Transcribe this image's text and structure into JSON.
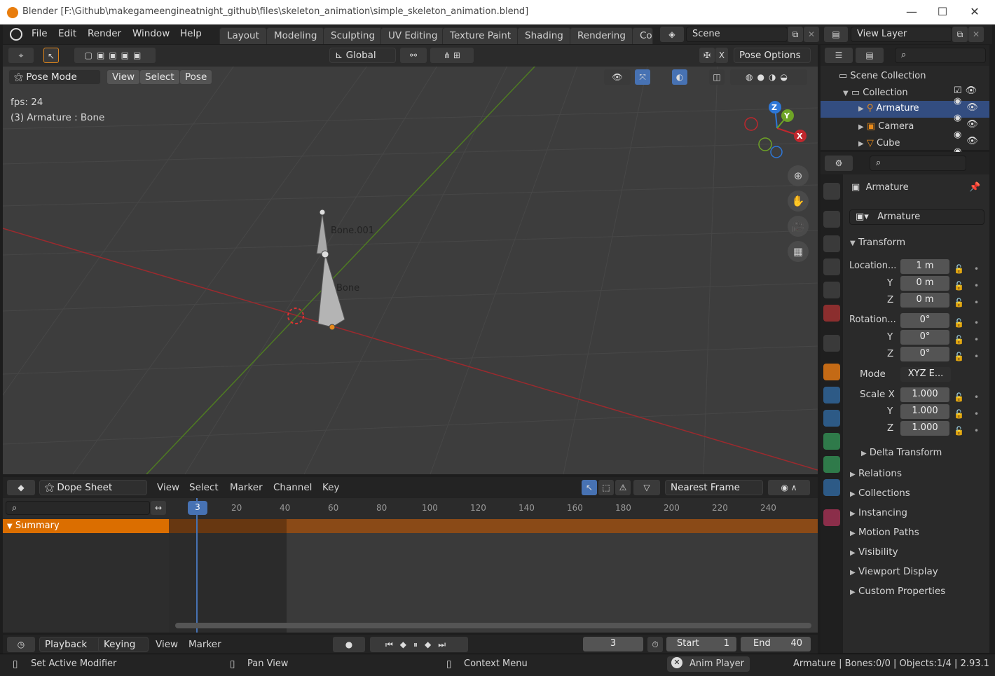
{
  "window": {
    "title": "Blender [F:\\Github\\makegameengineatnight_github\\files\\skeleton_animation\\simple_skeleton_animation.blend]",
    "minimize": "—",
    "maximize": "☐",
    "close": "✕"
  },
  "menu": [
    "File",
    "Edit",
    "Render",
    "Window",
    "Help"
  ],
  "workspaces": [
    "Layout",
    "Modeling",
    "Sculpting",
    "UV Editing",
    "Texture Paint",
    "Shading",
    "Rendering",
    "Co"
  ],
  "scene": {
    "label": "Scene"
  },
  "view_layer": {
    "label": "View Layer"
  },
  "viewport": {
    "orientation": "Global",
    "pose_options": "Pose Options",
    "mode": "Pose Mode",
    "menus": [
      "View",
      "Select",
      "Pose"
    ],
    "overlay_fps": "fps: 24",
    "overlay_object": "(3) Armature : Bone",
    "bones": [
      "Bone.001",
      "Bone"
    ],
    "gizmo_axes": {
      "x": "X",
      "y": "Y",
      "z": "Z"
    }
  },
  "outliner": {
    "scene_collection": "Scene Collection",
    "collection": "Collection",
    "items": [
      "Armature",
      "Camera",
      "Cube"
    ]
  },
  "properties": {
    "object_name": "Armature",
    "data_name": "Armature",
    "transform_label": "Transform",
    "location_label": "Location...",
    "location": [
      "1 m",
      "0 m",
      "0 m"
    ],
    "rotation_label": "Rotation...",
    "rotation": [
      "0°",
      "0°",
      "0°"
    ],
    "mode_label": "Mode",
    "mode_value": "XYZ E...",
    "scale_label": "Scale X",
    "scale": [
      "1.000",
      "1.000",
      "1.000"
    ],
    "axis_y": "Y",
    "axis_z": "Z",
    "delta_transform": "Delta Transform",
    "panels": [
      "Relations",
      "Collections",
      "Instancing",
      "Motion Paths",
      "Visibility",
      "Viewport Display",
      "Custom Properties"
    ]
  },
  "dopesheet": {
    "editor": "Dope Sheet",
    "menus": [
      "View",
      "Select",
      "Marker",
      "Channel",
      "Key"
    ],
    "snap": "Nearest Frame",
    "summary": "Summary",
    "current_frame": "3",
    "ruler": [
      "20",
      "40",
      "60",
      "80",
      "100",
      "120",
      "140",
      "160",
      "180",
      "200",
      "220",
      "240"
    ]
  },
  "timeline": {
    "playback": "Playback",
    "keying": "Keying",
    "menus": [
      "View",
      "Marker"
    ],
    "frame": "3",
    "start_label": "Start",
    "start": "1",
    "end_label": "End",
    "end": "40"
  },
  "status": {
    "left": "Set Active Modifier",
    "middle": "Pan View",
    "right": "Context Menu",
    "anim_player": "Anim Player",
    "info": "Armature | Bones:0/0 | Objects:1/4 | 2.93.1"
  },
  "colors": {
    "accent": "#4772b3",
    "summary": "#db6e00",
    "x_axis": "#c0272d",
    "y_axis": "#6ea326",
    "z_axis": "#2e77d8"
  }
}
